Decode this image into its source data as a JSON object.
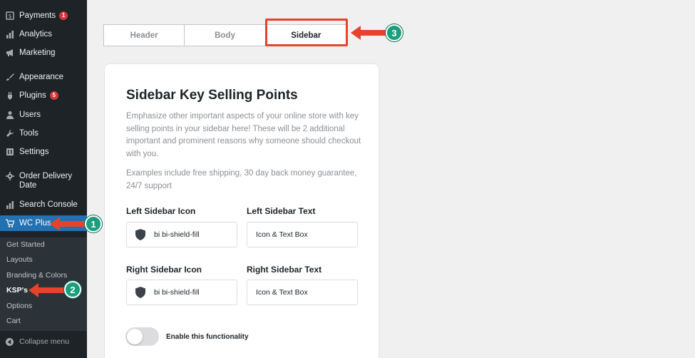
{
  "sidebar": {
    "items": [
      {
        "label": "Payments",
        "icon": "payments-icon",
        "badge": "1"
      },
      {
        "label": "Analytics",
        "icon": "analytics-icon"
      },
      {
        "label": "Marketing",
        "icon": "megaphone-icon"
      },
      {
        "label": "Appearance",
        "icon": "brush-icon"
      },
      {
        "label": "Plugins",
        "icon": "plugin-icon",
        "badge": "5"
      },
      {
        "label": "Users",
        "icon": "users-icon"
      },
      {
        "label": "Tools",
        "icon": "wrench-icon"
      },
      {
        "label": "Settings",
        "icon": "settings-icon"
      },
      {
        "label": "Order Delivery Date",
        "icon": "gear-icon"
      },
      {
        "label": "Search Console",
        "icon": "chart-icon"
      },
      {
        "label": "WC Plus",
        "icon": "cart-icon"
      }
    ],
    "submenu": [
      "Get Started",
      "Layouts",
      "Branding & Colors",
      "KSP's",
      "Options",
      "Cart"
    ],
    "collapse_label": "Collapse menu"
  },
  "tabs": [
    "Header",
    "Body",
    "Sidebar"
  ],
  "card": {
    "title": "Sidebar Key Selling Points",
    "description": "Emphasize other important aspects of your online store with key selling points in your sidebar here! These will be 2 additional important and prominent reasons why someone should checkout with you.",
    "examples": "Examples include free shipping, 30 day back money guarantee, 24/7 support",
    "left_icon_label": "Left Sidebar Icon",
    "left_icon_value": "bi bi-shield-fill",
    "left_text_label": "Left Sidebar Text",
    "left_text_value": "Icon & Text Box",
    "right_icon_label": "Right Sidebar Icon",
    "right_icon_value": "bi bi-shield-fill",
    "right_text_label": "Right Sidebar Text",
    "right_text_value": "Icon & Text Box",
    "toggle_label": "Enable this functionality"
  },
  "annotations": [
    "1",
    "2",
    "3"
  ],
  "colors": {
    "sidebar_bg": "#1d2327",
    "active_blue": "#2271b1",
    "annotation_red": "#e8412c",
    "annotation_green": "#1a9e7e"
  }
}
